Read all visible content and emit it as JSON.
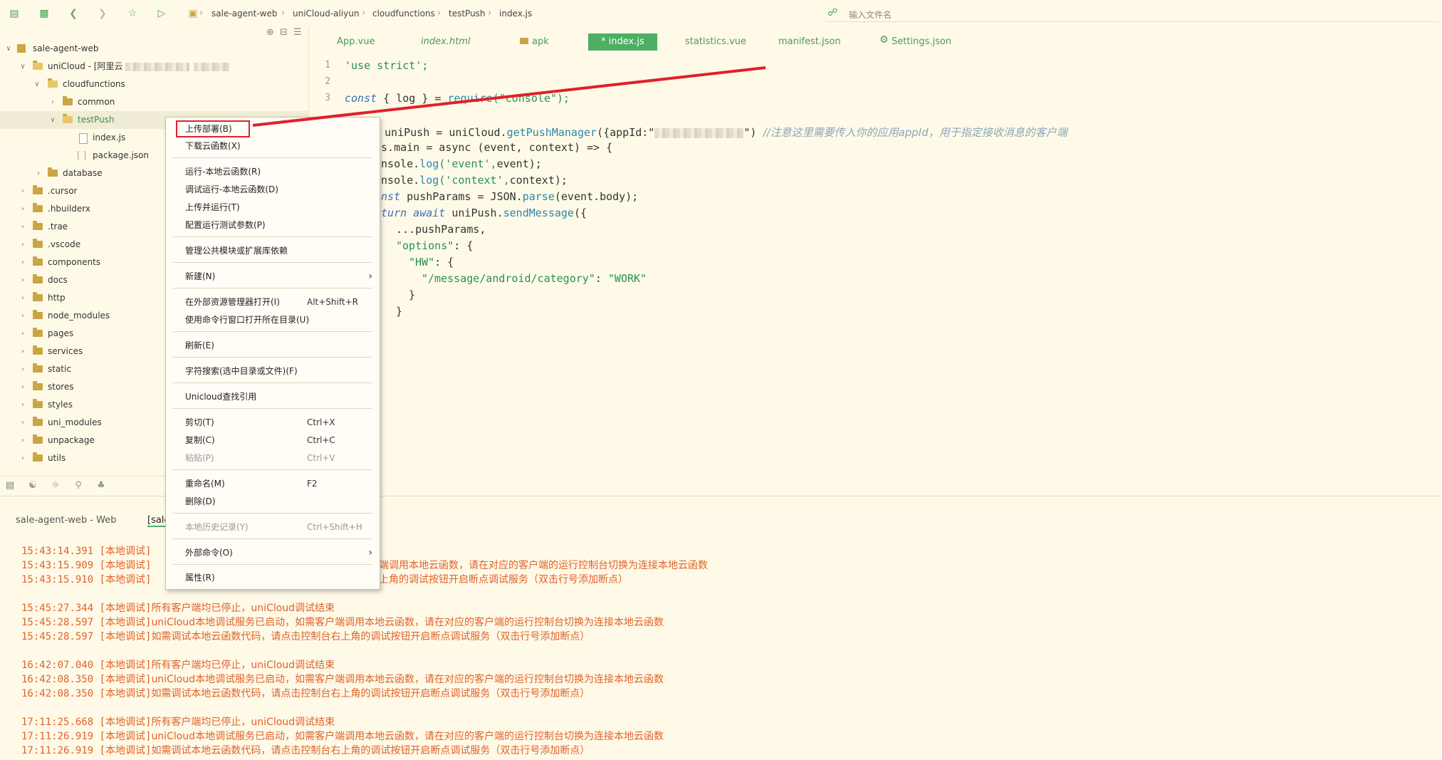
{
  "toolbar": {
    "breadcrumb": [
      "sale-agent-web",
      "uniCloud-aliyun",
      "cloudfunctions",
      "testPush",
      "index.js"
    ],
    "search_placeholder": "输入文件名"
  },
  "tree": {
    "root": "sale-agent-web",
    "unicloud_label": "uniCloud - [阿里云",
    "items": [
      {
        "label": "cloudfunctions"
      },
      {
        "label": "common"
      },
      {
        "label": "testPush"
      },
      {
        "label": "index.js"
      },
      {
        "label": "package.json"
      },
      {
        "label": "database"
      },
      {
        "label": ".cursor"
      },
      {
        "label": ".hbuilderx"
      },
      {
        "label": ".trae"
      },
      {
        "label": ".vscode"
      },
      {
        "label": "components"
      },
      {
        "label": "docs"
      },
      {
        "label": "http"
      },
      {
        "label": "node_modules"
      },
      {
        "label": "pages"
      },
      {
        "label": "services"
      },
      {
        "label": "static"
      },
      {
        "label": "stores"
      },
      {
        "label": "styles"
      },
      {
        "label": "uni_modules"
      },
      {
        "label": "unpackage"
      },
      {
        "label": "utils"
      }
    ]
  },
  "tabs": [
    {
      "label": "App.vue"
    },
    {
      "label": "index.html"
    },
    {
      "label": "apk"
    },
    {
      "label": "* index.js"
    },
    {
      "label": "statistics.vue"
    },
    {
      "label": "manifest.json"
    },
    {
      "label": "Settings.json"
    }
  ],
  "editor": {
    "line_numbers": [
      "1",
      "2",
      "3"
    ],
    "lines": {
      "l1": "'use strict';",
      "l3a": "const",
      "l3b": " { log } = ",
      "l3c": "require",
      "l3d": "(\"console\");",
      "l5a": " uniPush = uniCloud.",
      "l5b": "getPushManager",
      "l5c": "({appId:\"",
      "l5d": "\") ",
      "l5e": "//注意这里需要传入你的应用appId，用于指定接收消息的客户端",
      "l6": "ts.main = async (event, context) => {",
      "l7a": "onsole.",
      "l7b": "log",
      "l7c": "('event',",
      "l7d": "event);",
      "l8a": "onsole.",
      "l8b": "log",
      "l8c": "('context',",
      "l8d": "context);",
      "l9a": "onst",
      "l9b": " pushParams = JSON.",
      "l9c": "parse",
      "l9d": "(event.body);",
      "l10a": "eturn await",
      "l10b": " uniPush.",
      "l10c": "sendMessage",
      "l10d": "({",
      "l11": "...pushParams,",
      "l12a": "\"options\"",
      "l12b": ": {",
      "l13a": "\"HW\"",
      "l13b": ": {",
      "l14a": "\"/message/android/category\"",
      "l14b": ": ",
      "l14c": "\"WORK\"",
      "l15": "}",
      "l16": "}",
      "l17": ")"
    }
  },
  "context_menu": {
    "items": {
      "upload_deploy": "上传部署(B)",
      "download_cloud_fn": "下载云函数(X)",
      "run_local": "运行-本地云函数(R)",
      "debug_local": "调试运行-本地云函数(D)",
      "upload_run": "上传并运行(T)",
      "config_params": "配置运行测试参数(P)",
      "manage_modules": "管理公共模块或扩展库依赖",
      "new": "新建(N)",
      "open_explorer": "在外部资源管理器打开(I)",
      "open_explorer_sc": "Alt+Shift+R",
      "open_cmd": "使用命令行窗口打开所在目录(U)",
      "refresh": "刷新(E)",
      "search_chars": "字符搜索(选中目录或文件)(F)",
      "unicloud_find": "Unicloud查找引用",
      "cut": "剪切(T)",
      "cut_sc": "Ctrl+X",
      "copy": "复制(C)",
      "copy_sc": "Ctrl+C",
      "paste": "粘贴(P)",
      "paste_sc": "Ctrl+V",
      "rename": "重命名(M)",
      "rename_sc": "F2",
      "delete": "删除(D)",
      "local_history": "本地历史记录(Y)",
      "local_history_sc": "Ctrl+Shift+H",
      "external_cmd": "外部命令(O)",
      "properties": "属性(R)"
    }
  },
  "console": {
    "tab_web": "sale-agent-web - Web",
    "tab_active": "[sale",
    "logs": {
      "r1": "15:43:14.391 [本地调试]",
      "r2a": "15:43:15.909 [本地调试]",
      "r2b": "端调用本地云函数，请在对应的客户端的运行控制台切换为连接本地云函数",
      "r3a": "15:43:15.910 [本地调试]",
      "r3b": "上角的调试按钮开启断点调试服务（双击行号添加断点）",
      "r4a": "15:45:27.344 [本地调试]",
      "r4b": "所有客户端均已停止，uniCloud调试结束",
      "r5a": "15:45:28.597 [本地调试]",
      "r5b": "uniCloud本地调试服务已启动，如需客户端调用本地云函数，请在对应的客户端的运行控制台切换为连接本地云函数",
      "r6a": "15:45:28.597 [本地调试]",
      "r6b": "如需调试本地云函数代码，请点击控制台右上角的调试按钮开启断点调试服务（双击行号添加断点）",
      "r7a": "16:42:07.040 [本地调试]",
      "r7b": "所有客户端均已停止，uniCloud调试结束",
      "r8a": "16:42:08.350 [本地调试]",
      "r8b": "uniCloud本地调试服务已启动，如需客户端调用本地云函数，请在对应的客户端的运行控制台切换为连接本地云函数",
      "r9a": "16:42:08.350 [本地调试]",
      "r9b": "如需调试本地云函数代码，请点击控制台右上角的调试按钮开启断点调试服务（双击行号添加断点）",
      "r10a": "17:11:25.668 [本地调试]",
      "r10b": "所有客户端均已停止，uniCloud调试结束",
      "r11a": "17:11:26.919 [本地调试]",
      "r11b": "uniCloud本地调试服务已启动，如需客户端调用本地云函数，请在对应的客户端的运行控制台切换为连接本地云函数",
      "r12a": "17:11:26.919 [本地调试]",
      "r12b": "如需调试本地云函数代码，请点击控制台右上角的调试按钮开启断点调试服务（双击行号添加断点）"
    }
  },
  "colors": {
    "accent_green": "#4caf63",
    "console_orange": "#e0622a",
    "highlight_red": "#e0202c"
  }
}
